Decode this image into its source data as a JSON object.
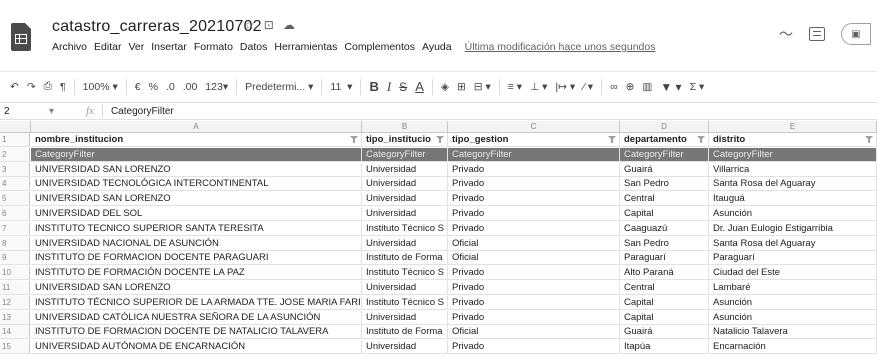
{
  "doc": {
    "title": "catastro_carreras_20210702",
    "last_edit": "Última modificación hace unos segundos"
  },
  "menu": [
    "Archivo",
    "Editar",
    "Ver",
    "Insertar",
    "Formato",
    "Datos",
    "Herramientas",
    "Complementos",
    "Ayuda"
  ],
  "toolbar": {
    "zoom": "100%",
    "currency": "€",
    "percent": "%",
    "dec_less": ".0",
    "dec_more": ".00",
    "format_more": "123",
    "font": "Predetermi...",
    "font_size": "11"
  },
  "formula_bar": {
    "name_box": "2",
    "fx": "fx",
    "content": "CategoryFilter"
  },
  "columns": [
    "A",
    "B",
    "C",
    "D",
    "E"
  ],
  "header": [
    "nombre_institucion",
    "tipo_institucio",
    "tipo_gestion",
    "departamento",
    "distrito"
  ],
  "filter_row": [
    "CategoryFilter",
    "CategoryFilter",
    "CategoryFilter",
    "CategoryFilter",
    "CategoryFilter"
  ],
  "rows": [
    [
      "UNIVERSIDAD SAN LORENZO",
      "Universidad",
      "Privado",
      "Guairá",
      "Villarrica"
    ],
    [
      "UNIVERSIDAD TECNOLÓGICA INTERCONTINENTAL",
      "Universidad",
      "Privado",
      "San Pedro",
      "Santa Rosa del Aguaray"
    ],
    [
      "UNIVERSIDAD SAN LORENZO",
      "Universidad",
      "Privado",
      "Central",
      "Itauguá"
    ],
    [
      "UNIVERSIDAD DEL SOL",
      "Universidad",
      "Privado",
      "Capital",
      "Asunción"
    ],
    [
      "INSTITUTO TECNICO SUPERIOR SANTA TERESITA",
      "Instituto Técnico S",
      "Privado",
      "Caaguazú",
      "Dr. Juan Eulogio Estigarribia"
    ],
    [
      "UNIVERSIDAD NACIONAL DE ASUNCIÓN",
      "Universidad",
      "Oficial",
      "San Pedro",
      "Santa Rosa del Aguaray"
    ],
    [
      "INSTITUTO DE FORMACION DOCENTE PARAGUARI",
      "Instituto de Forma",
      "Oficial",
      "Paraguarí",
      "Paraguarí"
    ],
    [
      "INSTITUTO DE FORMACIÓN DOCENTE LA PAZ",
      "Instituto Técnico S",
      "Privado",
      "Alto Paraná",
      "Ciudad del Este"
    ],
    [
      "UNIVERSIDAD SAN LORENZO",
      "Universidad",
      "Privado",
      "Central",
      "Lambaré"
    ],
    [
      "INSTITUTO TÉCNICO SUPERIOR DE LA ARMADA TTE. JOSE MARIA FARIÑA",
      "Instituto Técnico S",
      "Privado",
      "Capital",
      "Asunción"
    ],
    [
      "UNIVERSIDAD CATÓLICA NUESTRA SEÑORA DE LA ASUNCIÓN",
      "Universidad",
      "Privado",
      "Capital",
      "Asunción"
    ],
    [
      "INSTITUTO DE FORMACION DOCENTE DE NATALICIO TALAVERA",
      "Instituto de Forma",
      "Oficial",
      "Guairá",
      "Natalicio Talavera"
    ],
    [
      "UNIVERSIDAD AUTÓNOMA DE ENCARNACIÓN",
      "Universidad",
      "Privado",
      "Itapúa",
      "Encarnación"
    ]
  ],
  "row_numbers": [
    "1",
    "2",
    "3",
    "4",
    "5",
    "6",
    "7",
    "8",
    "9",
    "10",
    "11",
    "12",
    "13",
    "14",
    "15"
  ]
}
